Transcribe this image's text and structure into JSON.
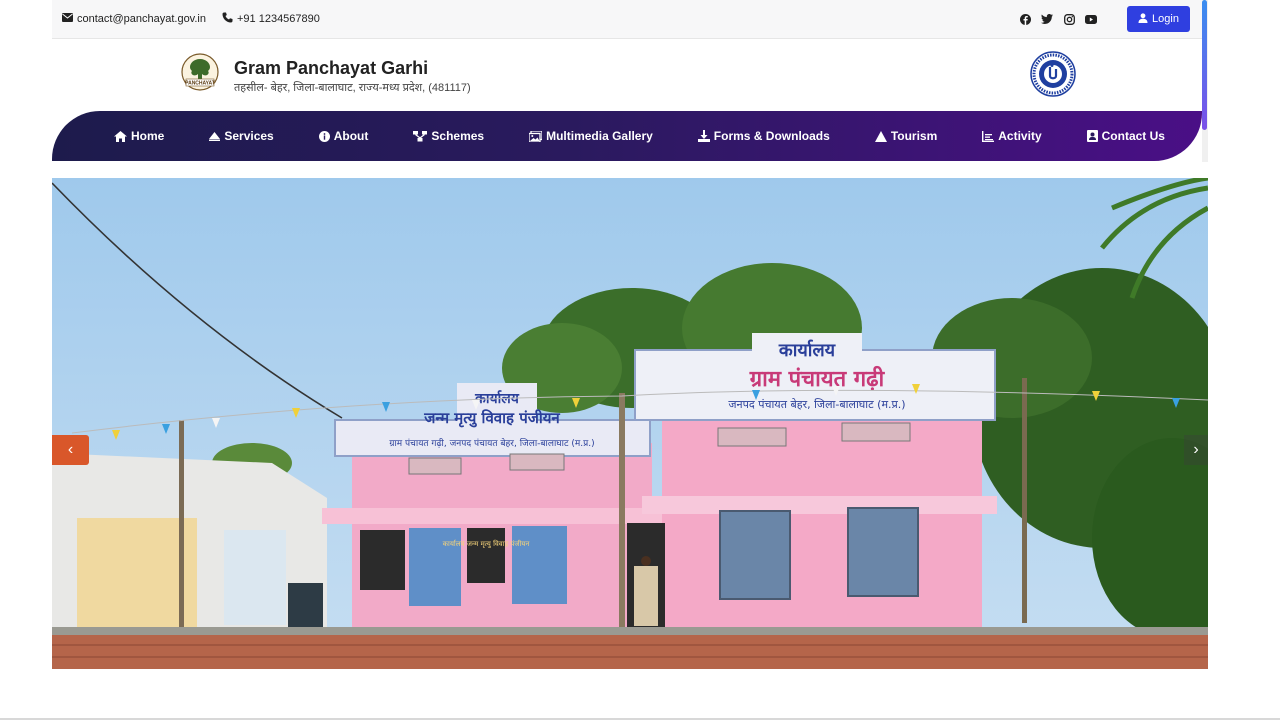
{
  "topbar": {
    "email": "contact@panchayat.gov.in",
    "phone": "+91 1234567890",
    "social_icons": [
      "facebook-icon",
      "twitter-icon",
      "instagram-icon",
      "youtube-icon"
    ],
    "login_label": "Login"
  },
  "header": {
    "title": "Gram Panchayat Garhi",
    "subtitle": "तहसील- बेहर, जिला-बालाघाट, राज्य-मध्य प्रदेश, (481117)",
    "emblem_text": "PANCHAYAT"
  },
  "nav": {
    "items": [
      {
        "label": "Home",
        "icon": "home-icon"
      },
      {
        "label": "Services",
        "icon": "services-icon"
      },
      {
        "label": "About",
        "icon": "info-icon"
      },
      {
        "label": "Schemes",
        "icon": "schemes-icon"
      },
      {
        "label": "Multimedia Gallery",
        "icon": "gallery-icon"
      },
      {
        "label": "Forms & Downloads",
        "icon": "download-icon"
      },
      {
        "label": "Tourism",
        "icon": "tourism-icon"
      },
      {
        "label": "Activity",
        "icon": "activity-icon"
      },
      {
        "label": "Contact Us",
        "icon": "contact-icon"
      }
    ]
  },
  "slider": {
    "prev_label": "‹",
    "next_label": "›",
    "sign_top": "कार्यालय",
    "sign_main": "ग्राम पंचायत गढ़ी",
    "sign_sub": "जनपद पंचायत बेहर, जिला-बालाघाट (म.प्र.)",
    "sign_left_top": "कार्यालय",
    "sign_left_main": "जन्म मृत्यु विवाह पंजीयन",
    "sign_left_sub": "ग्राम पंचायत गढ़ी, जनपद पंचायत बेहर, जिला-बालाघाट (म.प्र.)",
    "door_sign": "कार्यालय जन्म मृत्यु विवाह पंजीयन"
  },
  "colors": {
    "nav_start": "#1d1b4c",
    "nav_end": "#4a0f86",
    "login_bg": "#2f3fe0",
    "prev_arrow": "#d9572a"
  }
}
